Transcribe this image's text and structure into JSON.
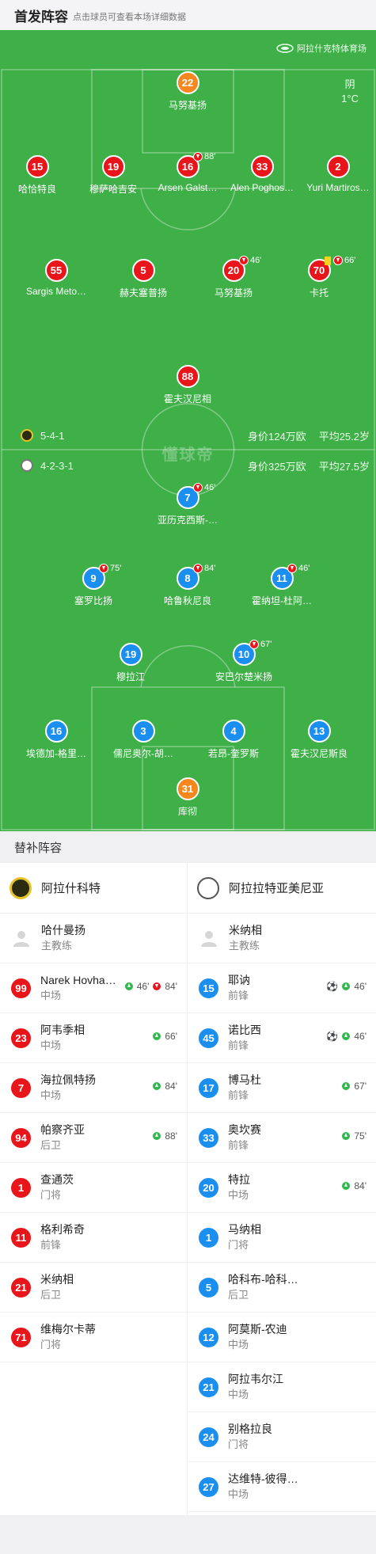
{
  "header": {
    "title": "首发阵容",
    "subtitle": "点击球员可查看本场详细数据"
  },
  "pitch": {
    "stadium": "阿拉什克特体育场",
    "weather": {
      "condition": "阴",
      "temp": "1°C"
    },
    "watermark": "懂球帝",
    "home_info": {
      "formation": "5-4-1",
      "value": "身价124万欧",
      "age": "平均25.2岁"
    },
    "away_info": {
      "formation": "4-2-3-1",
      "value": "身价325万欧",
      "age": "平均27.5岁"
    },
    "home_players": [
      {
        "num": "22",
        "name": "马努基扬",
        "color": "orange"
      },
      {
        "num": "15",
        "name": "哈恰特良",
        "color": "red"
      },
      {
        "num": "19",
        "name": "穆萨哈吉安",
        "color": "red"
      },
      {
        "num": "16",
        "name": "Arsen Galst…",
        "color": "red",
        "sub_out": "88'"
      },
      {
        "num": "33",
        "name": "Alen Poghos…",
        "color": "red"
      },
      {
        "num": "2",
        "name": "Yuri Martiros…",
        "color": "red"
      },
      {
        "num": "55",
        "name": "Sargis Meto…",
        "color": "red",
        "goals": "⚽⚽"
      },
      {
        "num": "5",
        "name": "赫夫塞普扬",
        "color": "red"
      },
      {
        "num": "20",
        "name": "马努基扬",
        "color": "red",
        "sub_out": "46'"
      },
      {
        "num": "70",
        "name": "卡托",
        "color": "red",
        "yellow": true,
        "sub_out": "66'"
      },
      {
        "num": "88",
        "name": "霍夫汉尼相",
        "color": "red"
      }
    ],
    "away_players": [
      {
        "num": "7",
        "name": "亚历克西斯-…",
        "color": "blue",
        "sub_out": "46'"
      },
      {
        "num": "9",
        "name": "塞罗比扬",
        "color": "blue",
        "sub_out": "75'",
        "assist": "⚽"
      },
      {
        "num": "8",
        "name": "哈鲁秋尼良",
        "color": "blue",
        "sub_out": "84'"
      },
      {
        "num": "11",
        "name": "霍纳坦-杜阿…",
        "color": "blue",
        "sub_out": "46'"
      },
      {
        "num": "19",
        "name": "穆拉江",
        "color": "blue"
      },
      {
        "num": "10",
        "name": "安巴尔楚米扬",
        "color": "blue",
        "sub_out": "67'",
        "captain": "C"
      },
      {
        "num": "16",
        "name": "埃德加-格里…",
        "color": "blue"
      },
      {
        "num": "3",
        "name": "儒尼奥尔-胡…",
        "color": "blue"
      },
      {
        "num": "4",
        "name": "若昂-奎罗斯",
        "color": "blue"
      },
      {
        "num": "13",
        "name": "霍夫汉尼斯良",
        "color": "blue"
      },
      {
        "num": "31",
        "name": "库彻",
        "color": "orange"
      }
    ]
  },
  "bench": {
    "title": "替补阵容",
    "home": {
      "team": "阿拉什科特",
      "coach": {
        "name": "哈什曼扬",
        "role": "主教练"
      },
      "players": [
        {
          "num": "99",
          "name": "Narek Hovha…",
          "pos": "中场",
          "color": "red",
          "ev_in": "46'",
          "ev_out": "84'"
        },
        {
          "num": "23",
          "name": "阿韦季相",
          "pos": "中场",
          "color": "red",
          "ev_in": "66'"
        },
        {
          "num": "7",
          "name": "海拉佩特扬",
          "pos": "中场",
          "color": "red",
          "ev_in": "84'"
        },
        {
          "num": "94",
          "name": "帕察齐亚",
          "pos": "后卫",
          "color": "red",
          "ev_in": "88'"
        },
        {
          "num": "1",
          "name": "查通茨",
          "pos": "门将",
          "color": "red"
        },
        {
          "num": "11",
          "name": "格利希奇",
          "pos": "前锋",
          "color": "red"
        },
        {
          "num": "21",
          "name": "米纳相",
          "pos": "后卫",
          "color": "red"
        },
        {
          "num": "71",
          "name": "维梅尔卡蒂",
          "pos": "门将",
          "color": "red"
        }
      ]
    },
    "away": {
      "team": "阿拉拉特亚美尼亚",
      "coach": {
        "name": "米纳相",
        "role": "主教练"
      },
      "players": [
        {
          "num": "15",
          "name": "耶讷",
          "pos": "前锋",
          "color": "blue",
          "goal": "⚽",
          "ev_in": "46'"
        },
        {
          "num": "45",
          "name": "诺比西",
          "pos": "前锋",
          "color": "blue",
          "goal": "⚽",
          "ev_in": "46'"
        },
        {
          "num": "17",
          "name": "博马杜",
          "pos": "前锋",
          "color": "blue",
          "ev_in": "67'"
        },
        {
          "num": "33",
          "name": "奥坎赛",
          "pos": "前锋",
          "color": "blue",
          "ev_in": "75'"
        },
        {
          "num": "20",
          "name": "特拉",
          "pos": "中场",
          "color": "blue",
          "ev_in": "84'"
        },
        {
          "num": "1",
          "name": "马纳相",
          "pos": "门将",
          "color": "blue"
        },
        {
          "num": "5",
          "name": "哈科布-哈科…",
          "pos": "后卫",
          "color": "blue"
        },
        {
          "num": "12",
          "name": "阿莫斯-农迪",
          "pos": "中场",
          "color": "blue"
        },
        {
          "num": "21",
          "name": "阿拉韦尔江",
          "pos": "中场",
          "color": "blue"
        },
        {
          "num": "24",
          "name": "别格拉良",
          "pos": "门将",
          "color": "blue"
        },
        {
          "num": "27",
          "name": "达维特-彼得…",
          "pos": "中场",
          "color": "blue"
        }
      ]
    }
  }
}
